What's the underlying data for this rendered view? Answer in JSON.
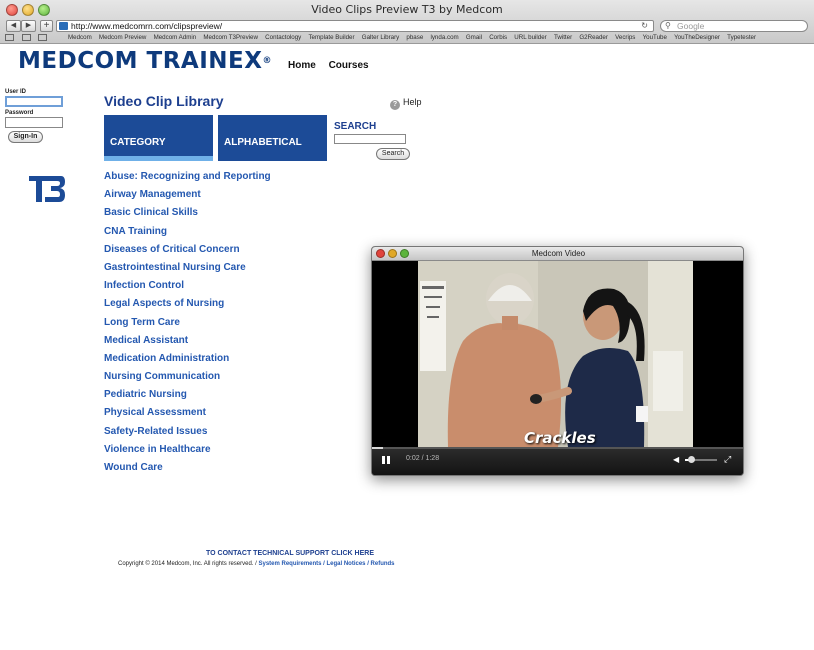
{
  "window": {
    "title": "Video Clips Preview T3 by Medcom"
  },
  "browser": {
    "url": "http://www.medcomrn.com/clipspreview/",
    "search_placeholder": "Google",
    "bookmarks": [
      "Medcom",
      "Medcom Preview",
      "Medcom Admin",
      "Medcom T3Preview",
      "Contactology",
      "Template Builder",
      "Galter Library",
      "pbase",
      "lynda.com",
      "Gmail",
      "Corbis",
      "URL builder",
      "Twitter",
      "G2Reader",
      "Vecrips",
      "YouTube",
      "YouTheDesigner",
      "Typetester"
    ]
  },
  "site": {
    "logo_text": "MEDCOM TRAINEX",
    "logo_mark": "®",
    "nav": {
      "home": "Home",
      "courses": "Courses"
    }
  },
  "login": {
    "user_label": "User ID",
    "password_label": "Password",
    "signin_label": "Sign-In"
  },
  "library": {
    "title": "Video Clip Library",
    "help_label": "Help",
    "tabs": {
      "category": "CATEGORY",
      "alphabetical": "ALPHABETICAL"
    },
    "search_title": "SEARCH",
    "search_button": "Search",
    "categories": [
      "Abuse: Recognizing and Reporting",
      "Airway Management",
      "Basic Clinical Skills",
      "CNA Training",
      "Diseases of Critical Concern",
      "Gastrointestinal Nursing Care",
      "Infection Control",
      "Legal Aspects of Nursing",
      "Long Term Care",
      "Medical Assistant",
      "Medication Administration",
      "Nursing Communication",
      "Pediatric Nursing",
      "Physical Assessment",
      "Safety-Related Issues",
      "Violence in Healthcare",
      "Wound Care"
    ]
  },
  "footer": {
    "support": "TO CONTACT TECHNICAL SUPPORT CLICK HERE",
    "copyright": "Copyright © 2014 Medcom, Inc. All rights reserved. / ",
    "links": "System Requirements / Legal Notices / Refunds"
  },
  "video": {
    "window_title": "Medcom Video",
    "caption": "Crackles",
    "time": "0:02 / 1:28",
    "progress": 0.03,
    "volume": 0.2
  },
  "colors": {
    "brand_blue": "#1c4b97",
    "link_blue": "#2458b0",
    "tab_underline": "#6fb0e8"
  }
}
